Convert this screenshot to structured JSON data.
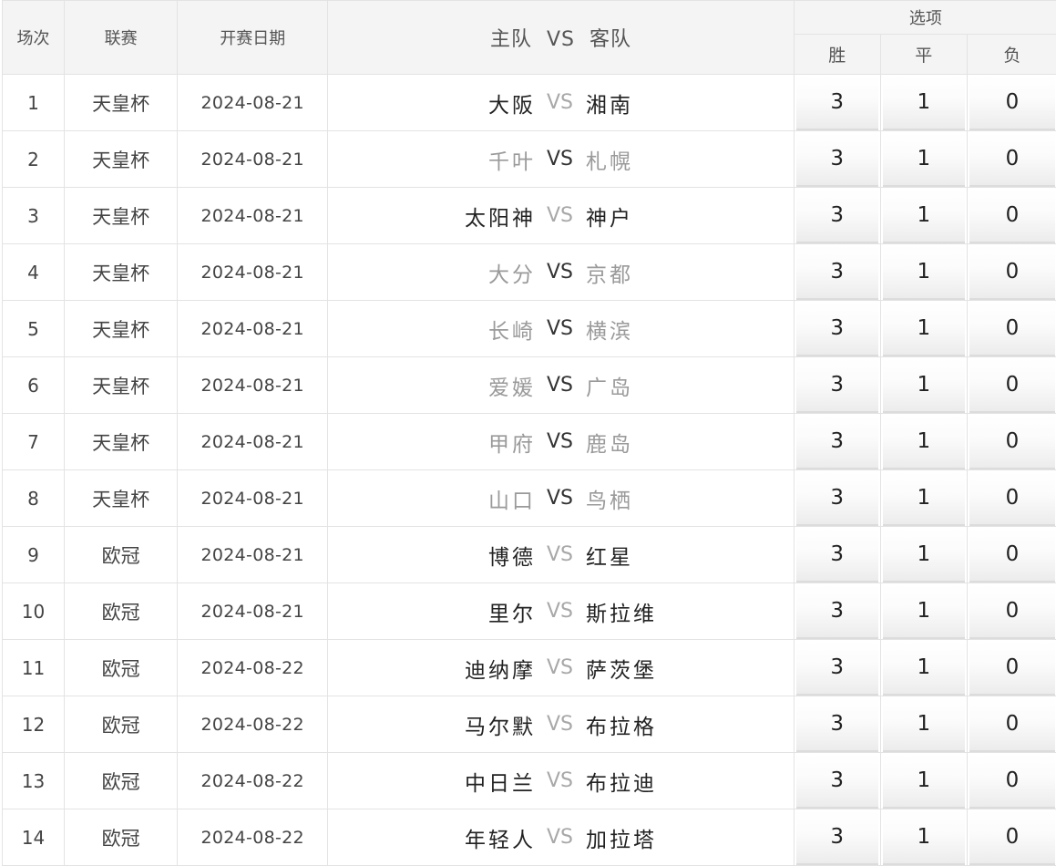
{
  "header": {
    "col_index": "场次",
    "col_league": "联赛",
    "col_date": "开赛日期",
    "col_home": "主队",
    "col_vs": "VS",
    "col_away": "客队",
    "col_options": "选项",
    "opt_win": "胜",
    "opt_draw": "平",
    "opt_loss": "负"
  },
  "rows": [
    {
      "idx": "1",
      "league": "天皇杯",
      "date": "2024-08-21",
      "home": "大阪",
      "vs": "VS",
      "away": "湘南",
      "style": "dark-light",
      "win": "3",
      "draw": "1",
      "loss": "0"
    },
    {
      "idx": "2",
      "league": "天皇杯",
      "date": "2024-08-21",
      "home": "千叶",
      "vs": "VS",
      "away": "札幌",
      "style": "light-dark",
      "win": "3",
      "draw": "1",
      "loss": "0"
    },
    {
      "idx": "3",
      "league": "天皇杯",
      "date": "2024-08-21",
      "home": "太阳神",
      "vs": "VS",
      "away": "神户",
      "style": "dark-light",
      "win": "3",
      "draw": "1",
      "loss": "0"
    },
    {
      "idx": "4",
      "league": "天皇杯",
      "date": "2024-08-21",
      "home": "大分",
      "vs": "VS",
      "away": "京都",
      "style": "light-dark",
      "win": "3",
      "draw": "1",
      "loss": "0"
    },
    {
      "idx": "5",
      "league": "天皇杯",
      "date": "2024-08-21",
      "home": "长崎",
      "vs": "VS",
      "away": "横滨",
      "style": "light-dark",
      "win": "3",
      "draw": "1",
      "loss": "0"
    },
    {
      "idx": "6",
      "league": "天皇杯",
      "date": "2024-08-21",
      "home": "爱媛",
      "vs": "VS",
      "away": "广岛",
      "style": "light-dark",
      "win": "3",
      "draw": "1",
      "loss": "0"
    },
    {
      "idx": "7",
      "league": "天皇杯",
      "date": "2024-08-21",
      "home": "甲府",
      "vs": "VS",
      "away": "鹿岛",
      "style": "light-dark",
      "win": "3",
      "draw": "1",
      "loss": "0"
    },
    {
      "idx": "8",
      "league": "天皇杯",
      "date": "2024-08-21",
      "home": "山口",
      "vs": "VS",
      "away": "鸟栖",
      "style": "light-dark",
      "win": "3",
      "draw": "1",
      "loss": "0"
    },
    {
      "idx": "9",
      "league": "欧冠",
      "date": "2024-08-21",
      "home": "博德",
      "vs": "VS",
      "away": "红星",
      "style": "dark-light",
      "win": "3",
      "draw": "1",
      "loss": "0"
    },
    {
      "idx": "10",
      "league": "欧冠",
      "date": "2024-08-21",
      "home": "里尔",
      "vs": "VS",
      "away": "斯拉维",
      "style": "dark-light",
      "win": "3",
      "draw": "1",
      "loss": "0"
    },
    {
      "idx": "11",
      "league": "欧冠",
      "date": "2024-08-22",
      "home": "迪纳摩",
      "vs": "VS",
      "away": "萨茨堡",
      "style": "dark-light",
      "win": "3",
      "draw": "1",
      "loss": "0"
    },
    {
      "idx": "12",
      "league": "欧冠",
      "date": "2024-08-22",
      "home": "马尔默",
      "vs": "VS",
      "away": "布拉格",
      "style": "dark-light",
      "win": "3",
      "draw": "1",
      "loss": "0"
    },
    {
      "idx": "13",
      "league": "欧冠",
      "date": "2024-08-22",
      "home": "中日兰",
      "vs": "VS",
      "away": "布拉迪",
      "style": "dark-light",
      "win": "3",
      "draw": "1",
      "loss": "0"
    },
    {
      "idx": "14",
      "league": "欧冠",
      "date": "2024-08-22",
      "home": "年轻人",
      "vs": "VS",
      "away": "加拉塔",
      "style": "dark-light",
      "win": "3",
      "draw": "1",
      "loss": "0"
    }
  ]
}
